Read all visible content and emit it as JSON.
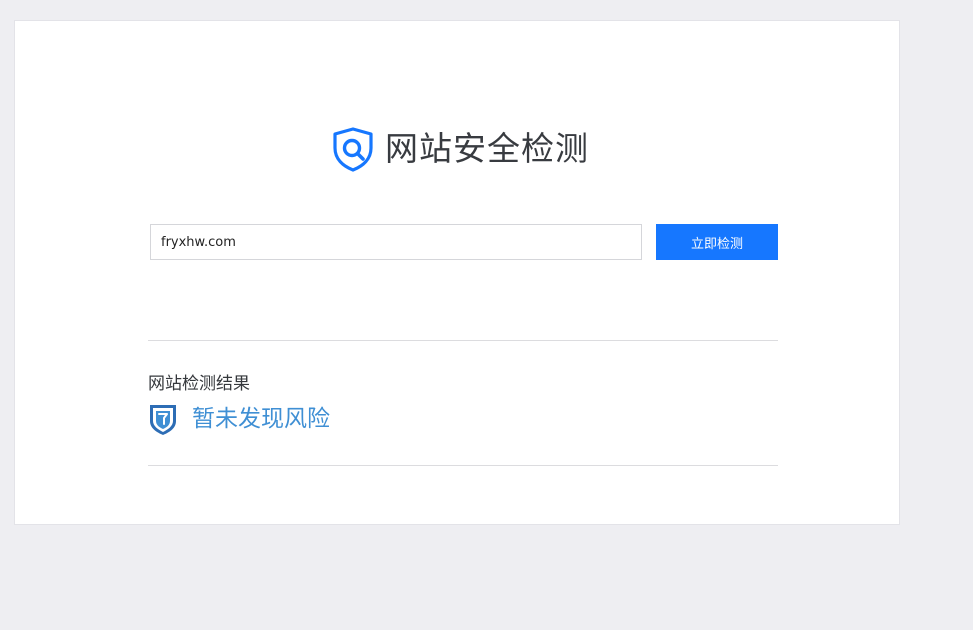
{
  "brand": {
    "title": "网站安全检测",
    "logo_icon": "shield-search-icon",
    "color": "#1677ff"
  },
  "search": {
    "value": "fryxhw.com",
    "placeholder": ""
  },
  "toolbar": {
    "check_label": "立即检测",
    "button_color": "#1677ff"
  },
  "result": {
    "label": "网站检测结果",
    "status": "暂未发现风险",
    "status_icon": "shield-check-icon",
    "status_color": "#3f8fd4"
  }
}
